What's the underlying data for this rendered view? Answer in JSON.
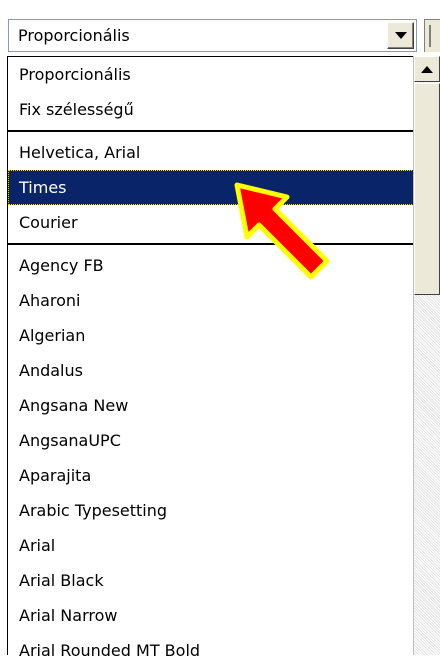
{
  "combo": {
    "selected_value": "Proporcionális"
  },
  "list": {
    "group1": [
      "Proporcionális",
      "Fix szélességű"
    ],
    "group2": [
      "Helvetica, Arial",
      "Times",
      "Courier"
    ],
    "group3": [
      "Agency FB",
      "Aharoni",
      "Algerian",
      "Andalus",
      "Angsana New",
      "AngsanaUPC",
      "Aparajita",
      "Arabic Typesetting",
      "Arial",
      "Arial Black",
      "Arial Narrow",
      "Arial Rounded MT Bold"
    ],
    "highlighted": "Times"
  },
  "icons": {
    "dropdown": "chevron-down-icon",
    "scroll_up": "scroll-up-arrow-icon",
    "annotation": "red-pointer-arrow-icon"
  },
  "colors": {
    "selection_bg": "#0a246a",
    "annotation_fill": "#ff0000",
    "annotation_outline": "#ffff00"
  }
}
